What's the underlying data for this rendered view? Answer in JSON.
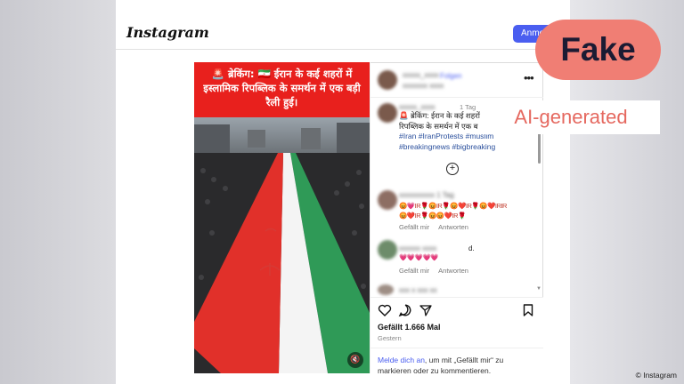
{
  "app": {
    "logo": "Instagram",
    "login_button": "Anmel"
  },
  "post": {
    "banner_text": "🚨 ब्रेकिंग: 🇮🇷 ईरान के कई शहरों में इस्लामिक रिपब्लिक के समर्थन में एक बड़ी रैली हुई।",
    "header_time": "1 Tag",
    "caption_line1": "🚨 ब्रेकिंग: ईरान के कई शहरों में",
    "caption_line2": "रिपब्लिक के समर्थन में एक ब",
    "hashtags_line1": "#Iran #IranProtests #muslim",
    "hashtags_line2": "#breakingnews #bigbreaking",
    "comment1_emojis_1": "😡💗IR🌹😡IR🌹😡❤️IR🌹😡❤️IRIR",
    "comment1_emojis_2": "😡❤️IR🌹😡😡❤️IR🌹",
    "comment2_suffix": "d.",
    "comment2_emojis": "💗💗💗💗💗",
    "comment_like": "Gefällt mir",
    "comment_reply": "Antworten",
    "likes": "Gefällt 1.666 Mal",
    "date": "Gestern",
    "login_link": "Melde dich an",
    "login_hint_rest": ", um mit „Gefällt mir“ zu markieren oder zu kommentieren."
  },
  "overlay": {
    "fake_label": "Fake",
    "ai_label": "AI-generated",
    "credit": "© Instagram"
  },
  "icons": [
    "heart-icon",
    "comment-icon",
    "share-icon",
    "bookmark-icon",
    "mute-icon",
    "more-options-icon",
    "add-comment-icon"
  ],
  "colors": {
    "banner_red": "#e8201d",
    "fake_badge": "#f07e74",
    "ai_text": "#e5685f",
    "login_blue": "#4a5ef0"
  }
}
